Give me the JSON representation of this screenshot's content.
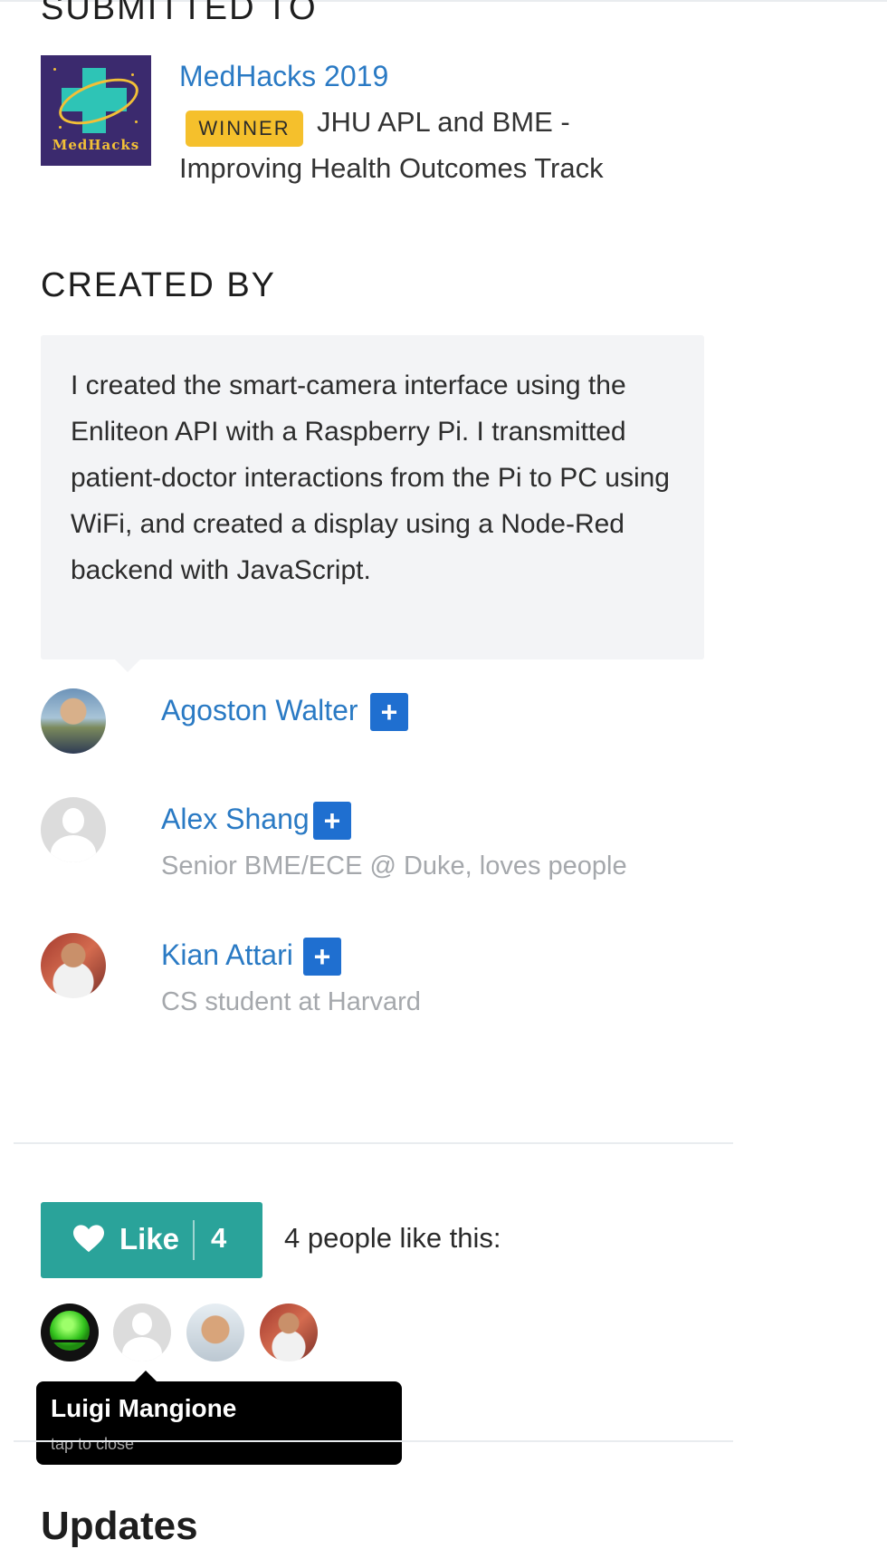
{
  "submitted": {
    "title": "SUBMITTED TO",
    "hackathon": {
      "name": "MedHacks 2019",
      "logo_text": "MedHacks",
      "badge": "WINNER",
      "prize_line1": "JHU APL and BME -",
      "prize_line2": "Improving Health Outcomes Track"
    }
  },
  "created_by": {
    "title": "CREATED BY",
    "bio": "I created the smart-camera interface using the Enliteon API with a Raspberry Pi. I transmitted patient-doctor interactions from the Pi to PC using WiFi, and created a display using a Node-Red backend with JavaScript.",
    "follow_symbol": "+",
    "members": [
      {
        "name": "Agoston Walter",
        "description": ""
      },
      {
        "name": "Alex Shang",
        "description": "Senior BME/ECE @ Duke, loves people"
      },
      {
        "name": "Kian Attari",
        "description": "CS student at Harvard"
      }
    ]
  },
  "likes": {
    "button_label": "Like",
    "count": "4",
    "summary": "4 people like this:",
    "tooltip": {
      "name": "Luigi Mangione",
      "hint": "tap to close"
    }
  },
  "updates": {
    "title": "Updates"
  },
  "colors": {
    "link": "#2a7ac4",
    "winner_badge": "#f5c02c",
    "like_button": "#2aa39a",
    "follow_button": "#1f6fd0"
  }
}
